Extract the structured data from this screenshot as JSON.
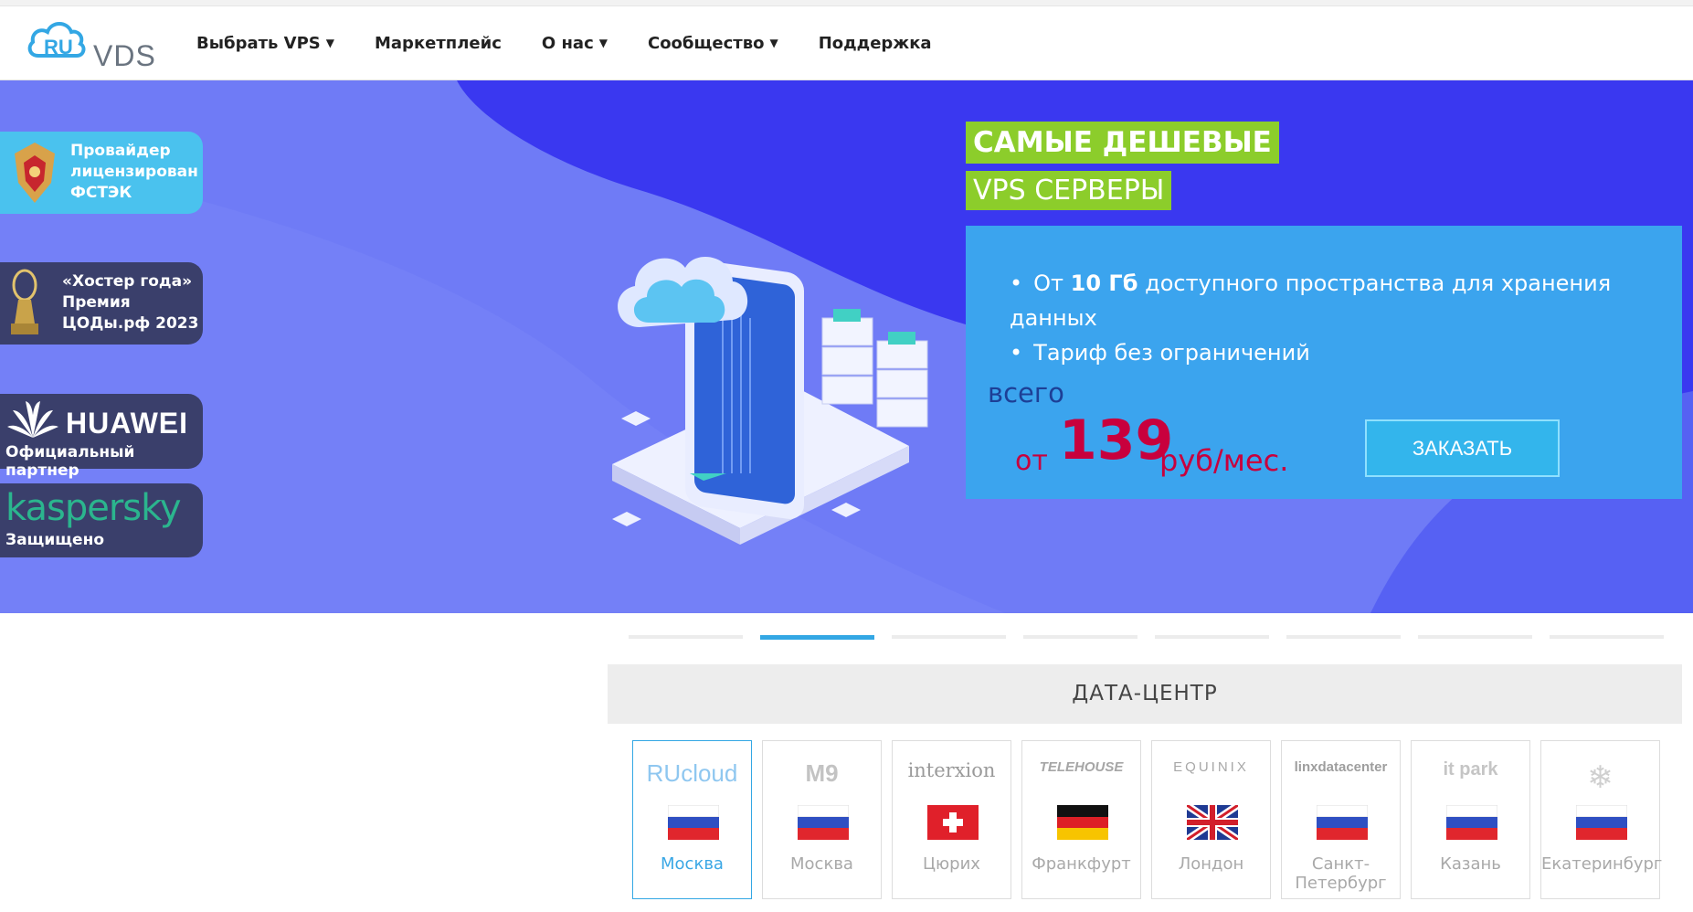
{
  "brand": {
    "logo_ru": "RU",
    "logo_vds": "VDS"
  },
  "nav": [
    {
      "label": "Выбрать VPS",
      "dropdown": true
    },
    {
      "label": "Маркетплейс",
      "dropdown": false
    },
    {
      "label": "О нас",
      "dropdown": true
    },
    {
      "label": "Сообщество",
      "dropdown": true
    },
    {
      "label": "Поддержка",
      "dropdown": false
    }
  ],
  "badges": {
    "fstek": [
      "Провайдер",
      "лицензирован",
      "ФСТЭК"
    ],
    "hoster": [
      "«Хостер года»",
      "Премия",
      "ЦОДы.рф 2023"
    ],
    "huawei": {
      "word": "HUAWEI",
      "sub": "Официальный партнер"
    },
    "kaspersky": {
      "word": "kaspersky",
      "sub": "Защищено"
    }
  },
  "hero": {
    "tag_line1": "САМЫЕ ДЕШЕВЫЕ",
    "tag_line2": "VPS СЕРВЕРЫ",
    "bullet1_pre": "От ",
    "bullet1_bold": "10 Гб",
    "bullet1_post": " доступного пространства для хранения данных",
    "bullet2": "Тариф без ограничений",
    "vsego": "всего",
    "ot": "от",
    "price": "139",
    "unit": "руб/мес.",
    "order_button": "ЗАКАЗАТЬ"
  },
  "slider": {
    "count": 8,
    "active_index": 1
  },
  "datacenter": {
    "title": "ДАТА-ЦЕНТР",
    "cards": [
      {
        "logo": "RUcloud",
        "city": "Москва",
        "flag": "ru",
        "active": true
      },
      {
        "logo": "M9",
        "city": "Москва",
        "flag": "ru",
        "active": false
      },
      {
        "logo": "interxion",
        "city": "Цюрих",
        "flag": "ch",
        "active": false
      },
      {
        "logo": "TELEHOUSE",
        "city": "Франкфурт",
        "flag": "de",
        "active": false
      },
      {
        "logo": "EQUINIX",
        "city": "Лондон",
        "flag": "uk",
        "active": false
      },
      {
        "logo": "linxdatacenter",
        "city": "Санкт-Петербург",
        "city_line1": "Санкт-",
        "city_line2": "Петербург",
        "flag": "ru",
        "active": false
      },
      {
        "logo": "it park",
        "city": "Казань",
        "flag": "ru",
        "active": false
      },
      {
        "logo": "snowflake-icon",
        "city": "Екатеринбург",
        "flag": "ru",
        "active": false
      }
    ]
  },
  "colors": {
    "accent": "#33a7e4",
    "hero_bg": "#6371f6",
    "tag_green": "#8ccd2b",
    "price_red": "#c8003d",
    "panel_blue": "#3ba4ee"
  }
}
